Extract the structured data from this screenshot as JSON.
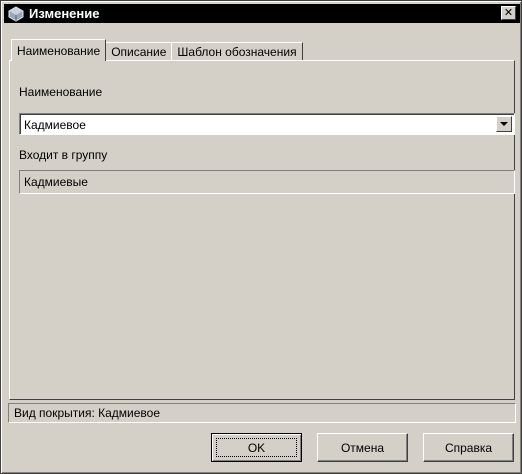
{
  "window": {
    "title": "Изменение",
    "close_glyph": "✕"
  },
  "tabs": [
    {
      "label": "Наименование",
      "active": true
    },
    {
      "label": "Описание",
      "active": false
    },
    {
      "label": "Шаблон обозначения",
      "active": false
    }
  ],
  "form": {
    "name_label": "Наименование",
    "name_value": "Кадмиевое",
    "group_label": "Входит в группу",
    "group_value": "Кадмиевые"
  },
  "status": {
    "text": "Вид покрытия: Кадмиевое"
  },
  "buttons": {
    "ok": "OK",
    "cancel": "Отмена",
    "help": "Справка"
  },
  "colors": {
    "face": "#d4d0c8",
    "titlebar": "#000000"
  }
}
